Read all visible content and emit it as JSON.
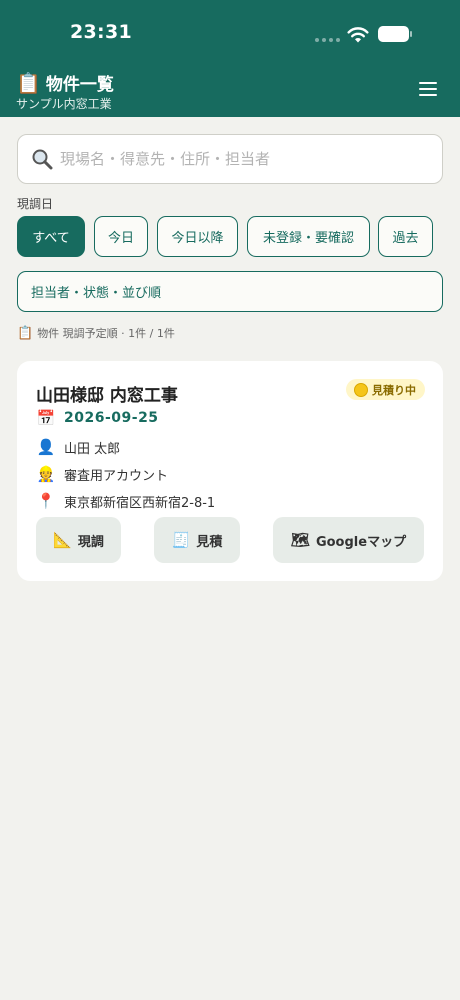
{
  "status_bar": {
    "time": "23:31"
  },
  "header": {
    "icon": "clipboard-icon",
    "title": "物件一覧",
    "subtitle": "サンプル内窓工業",
    "menu_icon": "hamburger-menu-icon"
  },
  "search": {
    "value": "",
    "placeholder": "現場名・得意先・住所・担当者"
  },
  "filters": {
    "label": "現調日",
    "chips": [
      {
        "label": "すべて",
        "active": true
      },
      {
        "label": "今日",
        "active": false
      },
      {
        "label": "今日以降",
        "active": false
      },
      {
        "label": "未登録・要確認",
        "active": false
      },
      {
        "label": "過去",
        "active": false
      }
    ],
    "more_label": "担当者・状態・並び順"
  },
  "result_summary": {
    "icon": "clipboard-icon",
    "text": "物件 現調予定順 · 1件 / 1件"
  },
  "cards": [
    {
      "title": "山田様邸 内窓工事",
      "status": "見積り中",
      "status_color": "#f5c518",
      "date": "2026-09-25",
      "customer": "山田 太郎",
      "account": "審査用アカウント",
      "address": "東京都新宿区西新宿2-8-1",
      "actions": {
        "survey": "現調",
        "estimate": "見積",
        "map": "Googleマップ"
      }
    }
  ],
  "colors": {
    "accent": "#176b5f",
    "background": "#f2f2ee",
    "button_bg": "#e7ece8"
  }
}
